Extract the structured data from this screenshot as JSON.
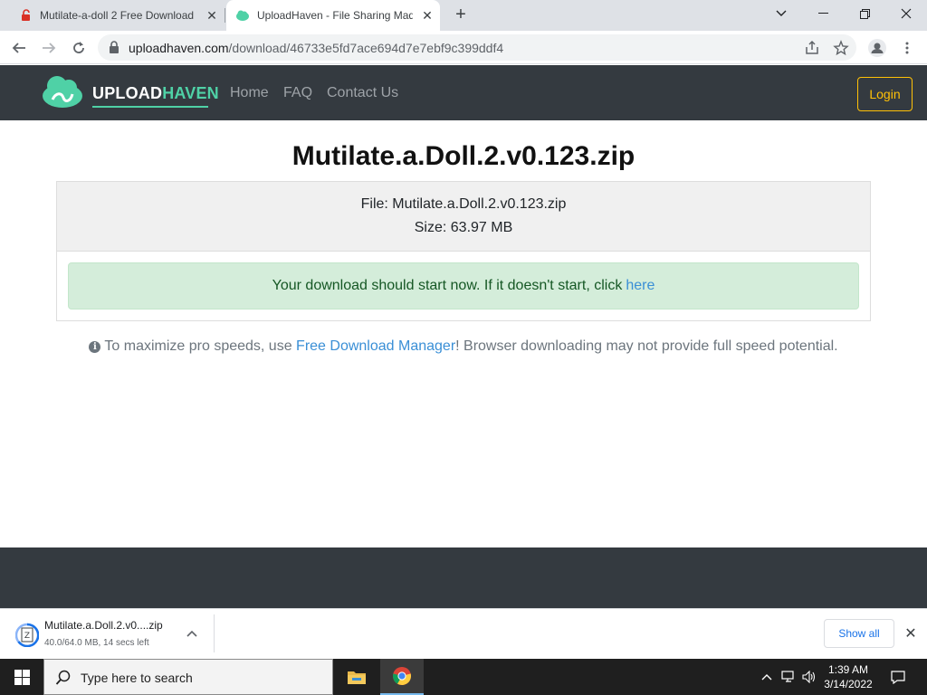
{
  "browser": {
    "tabs": [
      {
        "title": "Mutilate-a-doll 2 Free Download",
        "icon": "red-lock-icon",
        "active": false
      },
      {
        "title": "UploadHaven - File Sharing Mad",
        "icon": "uploadhaven-icon",
        "active": true
      }
    ],
    "url_host": "uploadhaven.com",
    "url_path": "/download/46733e5fd7ace694d7e7ebf9c399ddf4"
  },
  "site": {
    "logo_part1": "UPLOAD",
    "logo_part2": "HAVEN",
    "nav": [
      "Home",
      "FAQ",
      "Contact Us"
    ],
    "login_label": "Login"
  },
  "main": {
    "title": "Mutilate.a.Doll.2.v0.123.zip",
    "file_line": "File: Mutilate.a.Doll.2.v0.123.zip",
    "size_line": "Size: 63.97 MB",
    "alert_text": "Your download should start now. If it doesn't start, click",
    "alert_link": "here",
    "tip_before": "To maximize pro speeds, use ",
    "tip_link": "Free Download Manager",
    "tip_after": "! Browser downloading may not provide full speed potential."
  },
  "download_shelf": {
    "filename": "Mutilate.a.Doll.2.v0....zip",
    "status": "40.0/64.0 MB, 14 secs left",
    "show_all": "Show all"
  },
  "taskbar": {
    "search_placeholder": "Type here to search",
    "time": "1:39 AM",
    "date": "3/14/2022"
  },
  "colors": {
    "header_bg": "#343a40",
    "brand_green": "#4fd1a6",
    "login_yellow": "#ffc107",
    "alert_bg": "#d4edda",
    "link_blue": "#3a8fd6"
  }
}
